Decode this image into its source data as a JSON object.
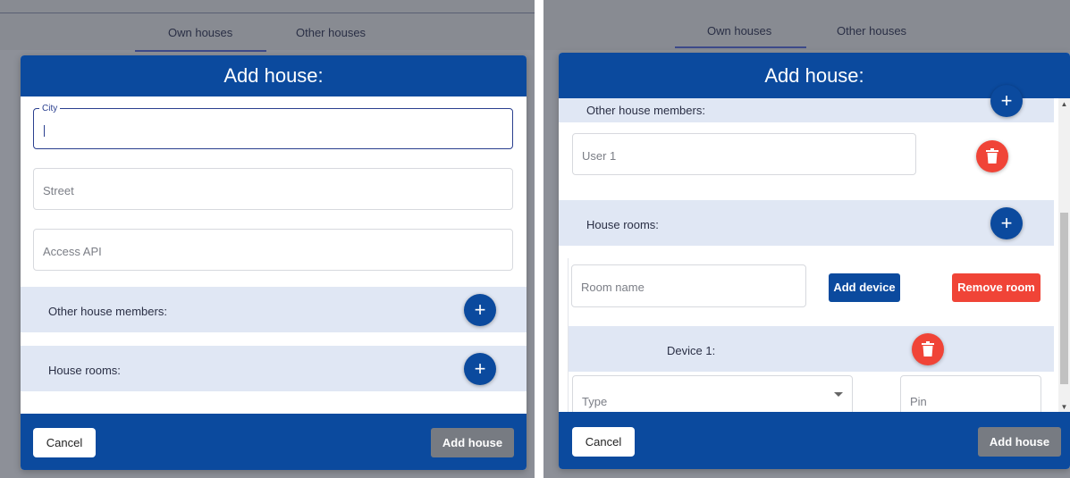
{
  "left": {
    "tabs": [
      {
        "label": "Own houses",
        "active": true
      },
      {
        "label": "Other houses",
        "active": false
      }
    ],
    "dialog": {
      "title": "Add house:",
      "city": {
        "label": "City",
        "value": ""
      },
      "street": {
        "placeholder": "Street"
      },
      "access_api": {
        "placeholder": "Access API"
      },
      "members_section": {
        "label": "Other house members:",
        "add_icon": "plus-icon"
      },
      "rooms_section": {
        "label": "House rooms:",
        "add_icon": "plus-icon"
      }
    },
    "footer": {
      "cancel_label": "Cancel",
      "add_label": "Add house"
    }
  },
  "right": {
    "tabs": [
      {
        "label": "Own houses",
        "active": true
      },
      {
        "label": "Other houses",
        "active": false
      }
    ],
    "dialog": {
      "title": "Add house:",
      "members_section": {
        "label": "Other house members:",
        "add_icon": "plus-icon"
      },
      "user_field": {
        "placeholder": "User 1",
        "delete_icon": "trash-icon"
      },
      "rooms_section": {
        "label": "House rooms:",
        "add_icon": "plus-icon"
      },
      "room": {
        "name_placeholder": "Room name",
        "add_device_label": "Add device",
        "remove_room_label": "Remove room",
        "device": {
          "label": "Device 1:",
          "delete_icon": "trash-icon",
          "type_placeholder": "Type",
          "pin_placeholder": "Pin"
        }
      }
    },
    "footer": {
      "cancel_label": "Cancel",
      "add_label": "Add house"
    }
  },
  "colors": {
    "primary": "#0b4a9e",
    "danger": "#f04437",
    "section_bg": "#e0e7f4",
    "disabled": "#777b82"
  }
}
